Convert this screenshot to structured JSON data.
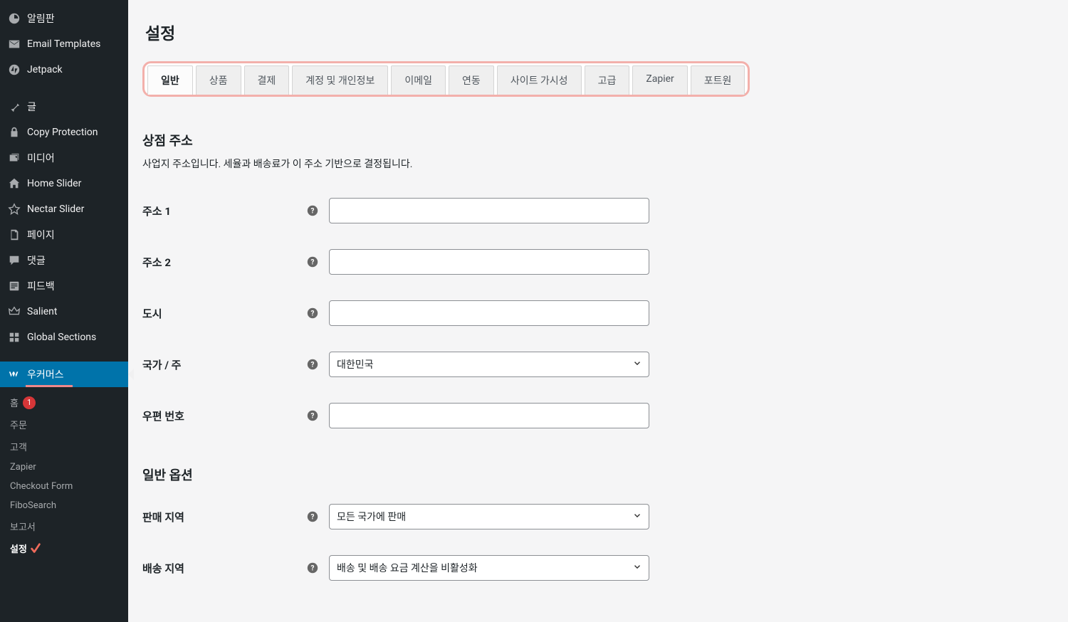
{
  "sidebar": {
    "items": [
      {
        "label": "알림판",
        "icon": "dashboard"
      },
      {
        "label": "Email Templates",
        "icon": "email"
      },
      {
        "label": "Jetpack",
        "icon": "jetpack"
      },
      {
        "label": "글",
        "icon": "pin"
      },
      {
        "label": "Copy Protection",
        "icon": "lock"
      },
      {
        "label": "미디어",
        "icon": "media"
      },
      {
        "label": "Home Slider",
        "icon": "home"
      },
      {
        "label": "Nectar Slider",
        "icon": "star"
      },
      {
        "label": "페이지",
        "icon": "page"
      },
      {
        "label": "댓글",
        "icon": "comment"
      },
      {
        "label": "피드백",
        "icon": "feedback"
      },
      {
        "label": "Salient",
        "icon": "crown"
      },
      {
        "label": "Global Sections",
        "icon": "sections"
      }
    ],
    "current": {
      "label": "우커머스",
      "icon": "woo"
    },
    "submenu": [
      {
        "label": "홈",
        "badge": "1"
      },
      {
        "label": "주문"
      },
      {
        "label": "고객"
      },
      {
        "label": "Zapier"
      },
      {
        "label": "Checkout Form"
      },
      {
        "label": "FiboSearch"
      },
      {
        "label": "보고서"
      },
      {
        "label": "설정",
        "active": true,
        "marker": true
      }
    ]
  },
  "page": {
    "title": "설정"
  },
  "tabs": [
    {
      "label": "일반",
      "active": true
    },
    {
      "label": "상품"
    },
    {
      "label": "결제"
    },
    {
      "label": "계정 및 개인정보"
    },
    {
      "label": "이메일"
    },
    {
      "label": "연동"
    },
    {
      "label": "사이트 가시성"
    },
    {
      "label": "고급"
    },
    {
      "label": "Zapier"
    },
    {
      "label": "포트원"
    }
  ],
  "sections": {
    "store_address": {
      "title": "상점 주소",
      "desc": "사업지 주소입니다. 세율과 배송료가 이 주소 기반으로 결정됩니다.",
      "fields": {
        "address1": {
          "label": "주소 1",
          "value": ""
        },
        "address2": {
          "label": "주소 2",
          "value": ""
        },
        "city": {
          "label": "도시",
          "value": ""
        },
        "country": {
          "label": "국가 / 주",
          "value": "대한민국"
        },
        "postcode": {
          "label": "우편 번호",
          "value": ""
        }
      }
    },
    "general_options": {
      "title": "일반 옵션",
      "fields": {
        "selling_location": {
          "label": "판매 지역",
          "value": "모든 국가에 판매"
        },
        "shipping_location": {
          "label": "배송 지역",
          "value": "배송 및 배송 요금 계산을 비활성화"
        }
      }
    }
  }
}
